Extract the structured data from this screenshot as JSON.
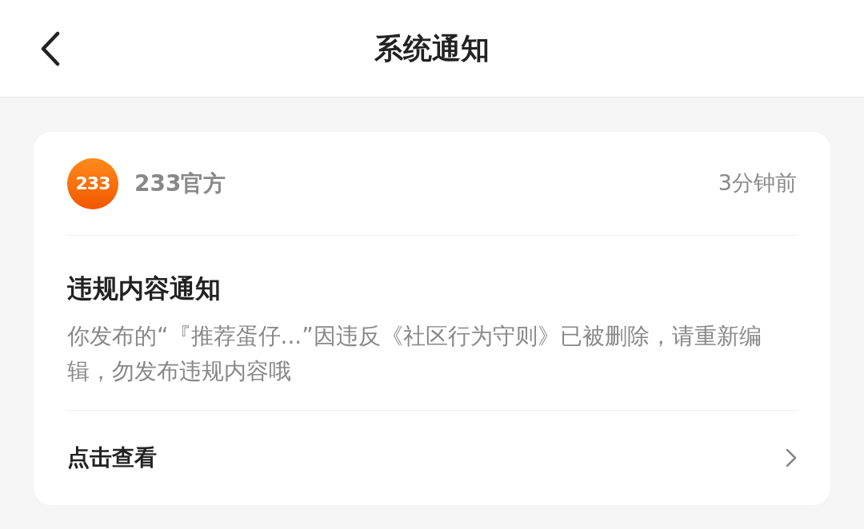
{
  "header": {
    "title": "系统通知"
  },
  "notification": {
    "sender": {
      "logo_text": "233",
      "name": "233官方"
    },
    "time": "3分钟前",
    "title": "违规内容通知",
    "body": "你发布的“『推荐蛋仔...”因违反《社区行为守则》已被删除，请重新编辑，勿发布违规内容哦",
    "action": "点击查看"
  }
}
